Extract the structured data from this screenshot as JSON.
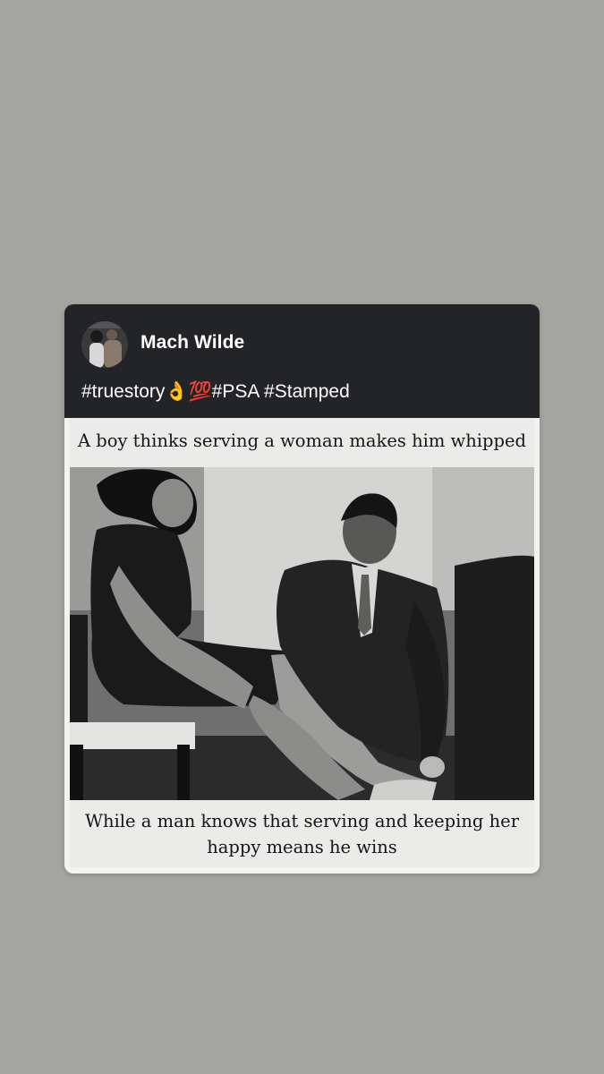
{
  "post": {
    "author": "Mach Wilde",
    "avatar_icon": "profile-photo-icon",
    "caption": "#truestory👌💯#PSA #Stamped"
  },
  "meme": {
    "top_text": "A boy thinks serving a woman makes him whipped",
    "bottom_line_1": "While a man knows that serving and keeping her",
    "bottom_line_2": "happy means he wins",
    "photo_description_icon": "black-and-white-photo-icon"
  },
  "colors": {
    "background": "#a4a5a0",
    "header": "#232427",
    "card": "#f2f2f0"
  }
}
